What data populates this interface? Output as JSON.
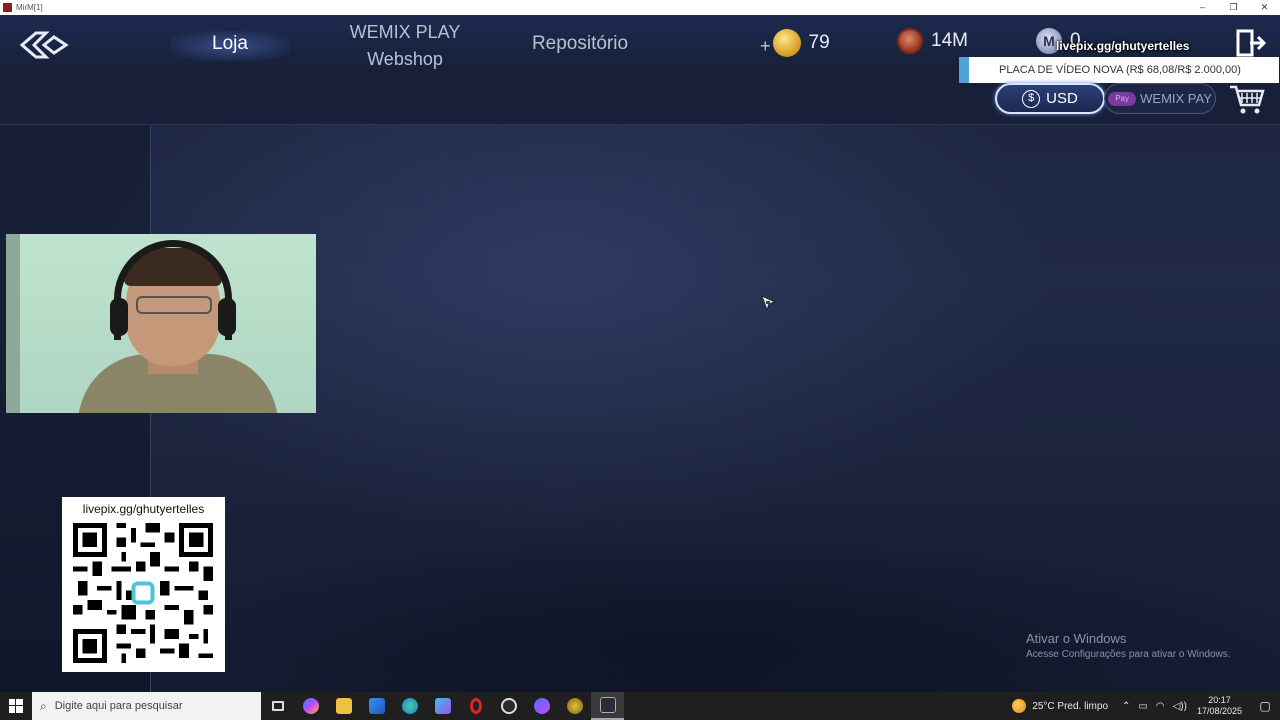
{
  "window": {
    "title": "MirM[1]",
    "controls": [
      "–",
      "❐",
      "✕"
    ]
  },
  "nav": {
    "tabs": [
      {
        "label": "Loja",
        "active": true
      },
      {
        "label_line1": "WEMIX PLAY",
        "label_line2": "Webshop"
      },
      {
        "label": "Repositório"
      }
    ]
  },
  "currencies": {
    "gold": {
      "plus": "+",
      "value": "79"
    },
    "red": {
      "value": "14M"
    },
    "m": {
      "symbol": "M",
      "value": "0"
    }
  },
  "overlay": {
    "link": "livepix.gg/ghutyertelles",
    "goal": "PLACA DE VÍDEO NOVA (R$ 68,08/R$ 2.000,00)",
    "qr_label": "livepix.gg/ghutyertelles"
  },
  "payment": {
    "usd_label": "USD",
    "usd_symbol": "$",
    "wemix_pay_label": "WEMIX PAY",
    "pay_badge": "Pay"
  },
  "activation": {
    "title": "Ativar o Windows",
    "subtitle": "Acesse Configurações para ativar o Windows."
  },
  "taskbar": {
    "search_placeholder": "Digite aqui para pesquisar",
    "weather": "25°C  Pred. limpo",
    "time": "20:17",
    "date": "17/08/2025",
    "apps": [
      "task-view",
      "copilot",
      "file-explorer",
      "store",
      "edge",
      "designer",
      "opera",
      "browser",
      "messenger",
      "game-launcher",
      "mirm"
    ]
  }
}
